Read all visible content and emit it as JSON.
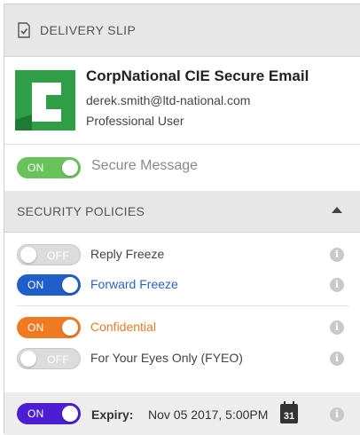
{
  "header": {
    "title": "DELIVERY SLIP",
    "icon": "document-check-icon"
  },
  "profile": {
    "name": "CorpNational CIE Secure Email",
    "email": "derek.smith@ltd-national.com",
    "role": "Professional User",
    "logo_letter": "C",
    "logo_color": "#2f9e47"
  },
  "secure_message": {
    "toggle_label": "ON",
    "label": "Secure Message",
    "on": true,
    "color": "#6ac35a"
  },
  "security_policies": {
    "title": "SECURITY POLICIES",
    "items": [
      {
        "toggle_label": "OFF",
        "label": "Reply Freeze",
        "on": false,
        "text_color": "#444444"
      },
      {
        "toggle_label": "ON",
        "label": "Forward Freeze",
        "on": true,
        "color": "#1e5fc9",
        "text_color": "#2a63c8"
      },
      {
        "toggle_label": "ON",
        "label": "Confidential",
        "on": true,
        "color": "#f07a22",
        "text_color": "#ef7a25"
      },
      {
        "toggle_label": "OFF",
        "label": "For Your Eyes Only (FYEO)",
        "on": false,
        "text_color": "#444444"
      }
    ]
  },
  "expiry": {
    "toggle_label": "ON",
    "label": "Expiry:",
    "value": "Nov 05 2017, 5:00PM",
    "on": true,
    "color": "#4b1ed1",
    "calendar_day": "31"
  },
  "info_glyph": "i"
}
